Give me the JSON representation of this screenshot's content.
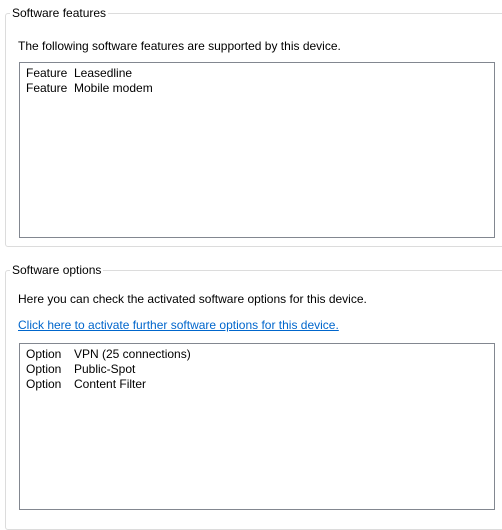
{
  "software_features": {
    "title": "Software features",
    "description": "The following software features are supported by this device.",
    "items": [
      {
        "kind": "Feature",
        "name": "Leasedline"
      },
      {
        "kind": "Feature",
        "name": "Mobile modem"
      }
    ]
  },
  "software_options": {
    "title": "Software options",
    "description": "Here you can check the activated software options for this device.",
    "link": "Click here to activate further software options for this device.",
    "items": [
      {
        "kind": "Option",
        "name": "VPN (25 connections)"
      },
      {
        "kind": "Option",
        "name": "Public-Spot"
      },
      {
        "kind": "Option",
        "name": "Content Filter"
      }
    ]
  }
}
